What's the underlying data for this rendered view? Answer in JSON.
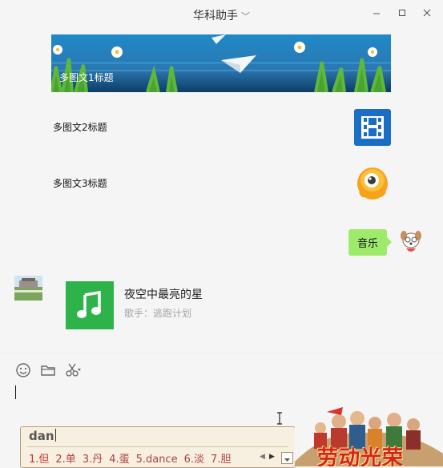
{
  "window": {
    "title": "华科助手",
    "title_dropdown_icon": "chevron-down-icon",
    "controls": [
      "minimize",
      "maximize",
      "close"
    ]
  },
  "chat": {
    "article_card": {
      "items": [
        {
          "title": "多图文1标题",
          "image": "sky-paper-plane-grass"
        },
        {
          "title": "多图文2标题",
          "image": "blue-film-icon"
        },
        {
          "title": "多图文3标题",
          "image": "yellow-mascot-icon"
        }
      ]
    },
    "outgoing_message": {
      "text": "音乐",
      "avatar": "cartoon-dog-avatar"
    },
    "music_card": {
      "sender_avatar": "building-photo-avatar",
      "title": "夜空中最亮的星",
      "artist": "歌手：逃跑计划",
      "cover_color": "#2eb34b"
    }
  },
  "input_toolbar": {
    "icons": [
      "emoji-icon",
      "folder-icon",
      "scissors-icon"
    ]
  },
  "ime": {
    "input": "dan",
    "candidates": [
      "1.但",
      "2.单",
      "3.丹",
      "4.蛋",
      "5.dance",
      "6.淡",
      "7.胆"
    ],
    "poster_text": "劳动光荣"
  },
  "colors": {
    "bubble_out": "#9eea6a",
    "music_cover": "#2eb34b",
    "app_bg": "#f5f5f5",
    "ime_bg": "#f7efe0",
    "candidate_text": "#b0413e"
  }
}
